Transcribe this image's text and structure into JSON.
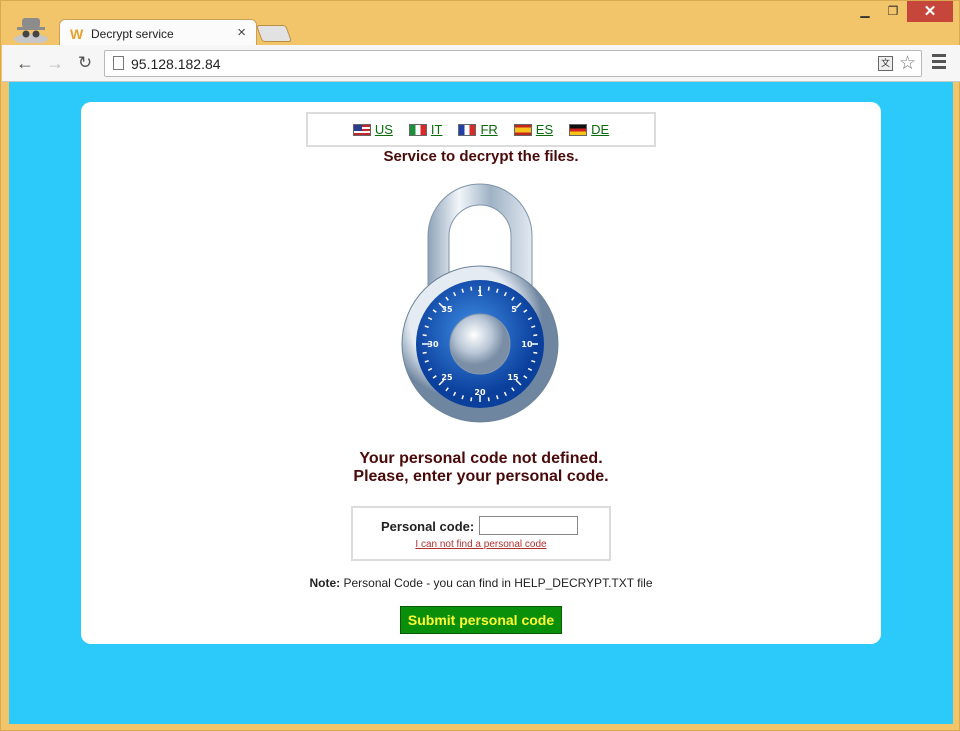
{
  "browser": {
    "tab": {
      "title": "Decrypt service",
      "favicon": "W"
    },
    "url": "95.128.182.84"
  },
  "colors": {
    "page_background": "#2cc9fb",
    "card_background": "#ffffff",
    "heading_text": "#4a0a0a",
    "submit_button": "#0a8f0a",
    "submit_text": "#ffff33"
  },
  "languages": [
    {
      "code": "US",
      "flag": "flag-us"
    },
    {
      "code": "IT",
      "flag": "flag-it"
    },
    {
      "code": "FR",
      "flag": "flag-fr"
    },
    {
      "code": "ES",
      "flag": "flag-es"
    },
    {
      "code": "DE",
      "flag": "flag-de"
    }
  ],
  "headline": "Service to decrypt the files.",
  "padlock": {
    "dial_numbers": [
      "1",
      "5",
      "10",
      "15",
      "20",
      "25",
      "30",
      "35"
    ]
  },
  "message": {
    "line1": "Your personal code not defined.",
    "line2": "Please, enter your personal code."
  },
  "form": {
    "label": "Personal code:",
    "value": "",
    "help_link": "I can not find a personal code"
  },
  "note": {
    "prefix": "Note:",
    "text": "Personal Code - you can find in HELP_DECRYPT.TXT file"
  },
  "submit_label": "Submit personal code"
}
